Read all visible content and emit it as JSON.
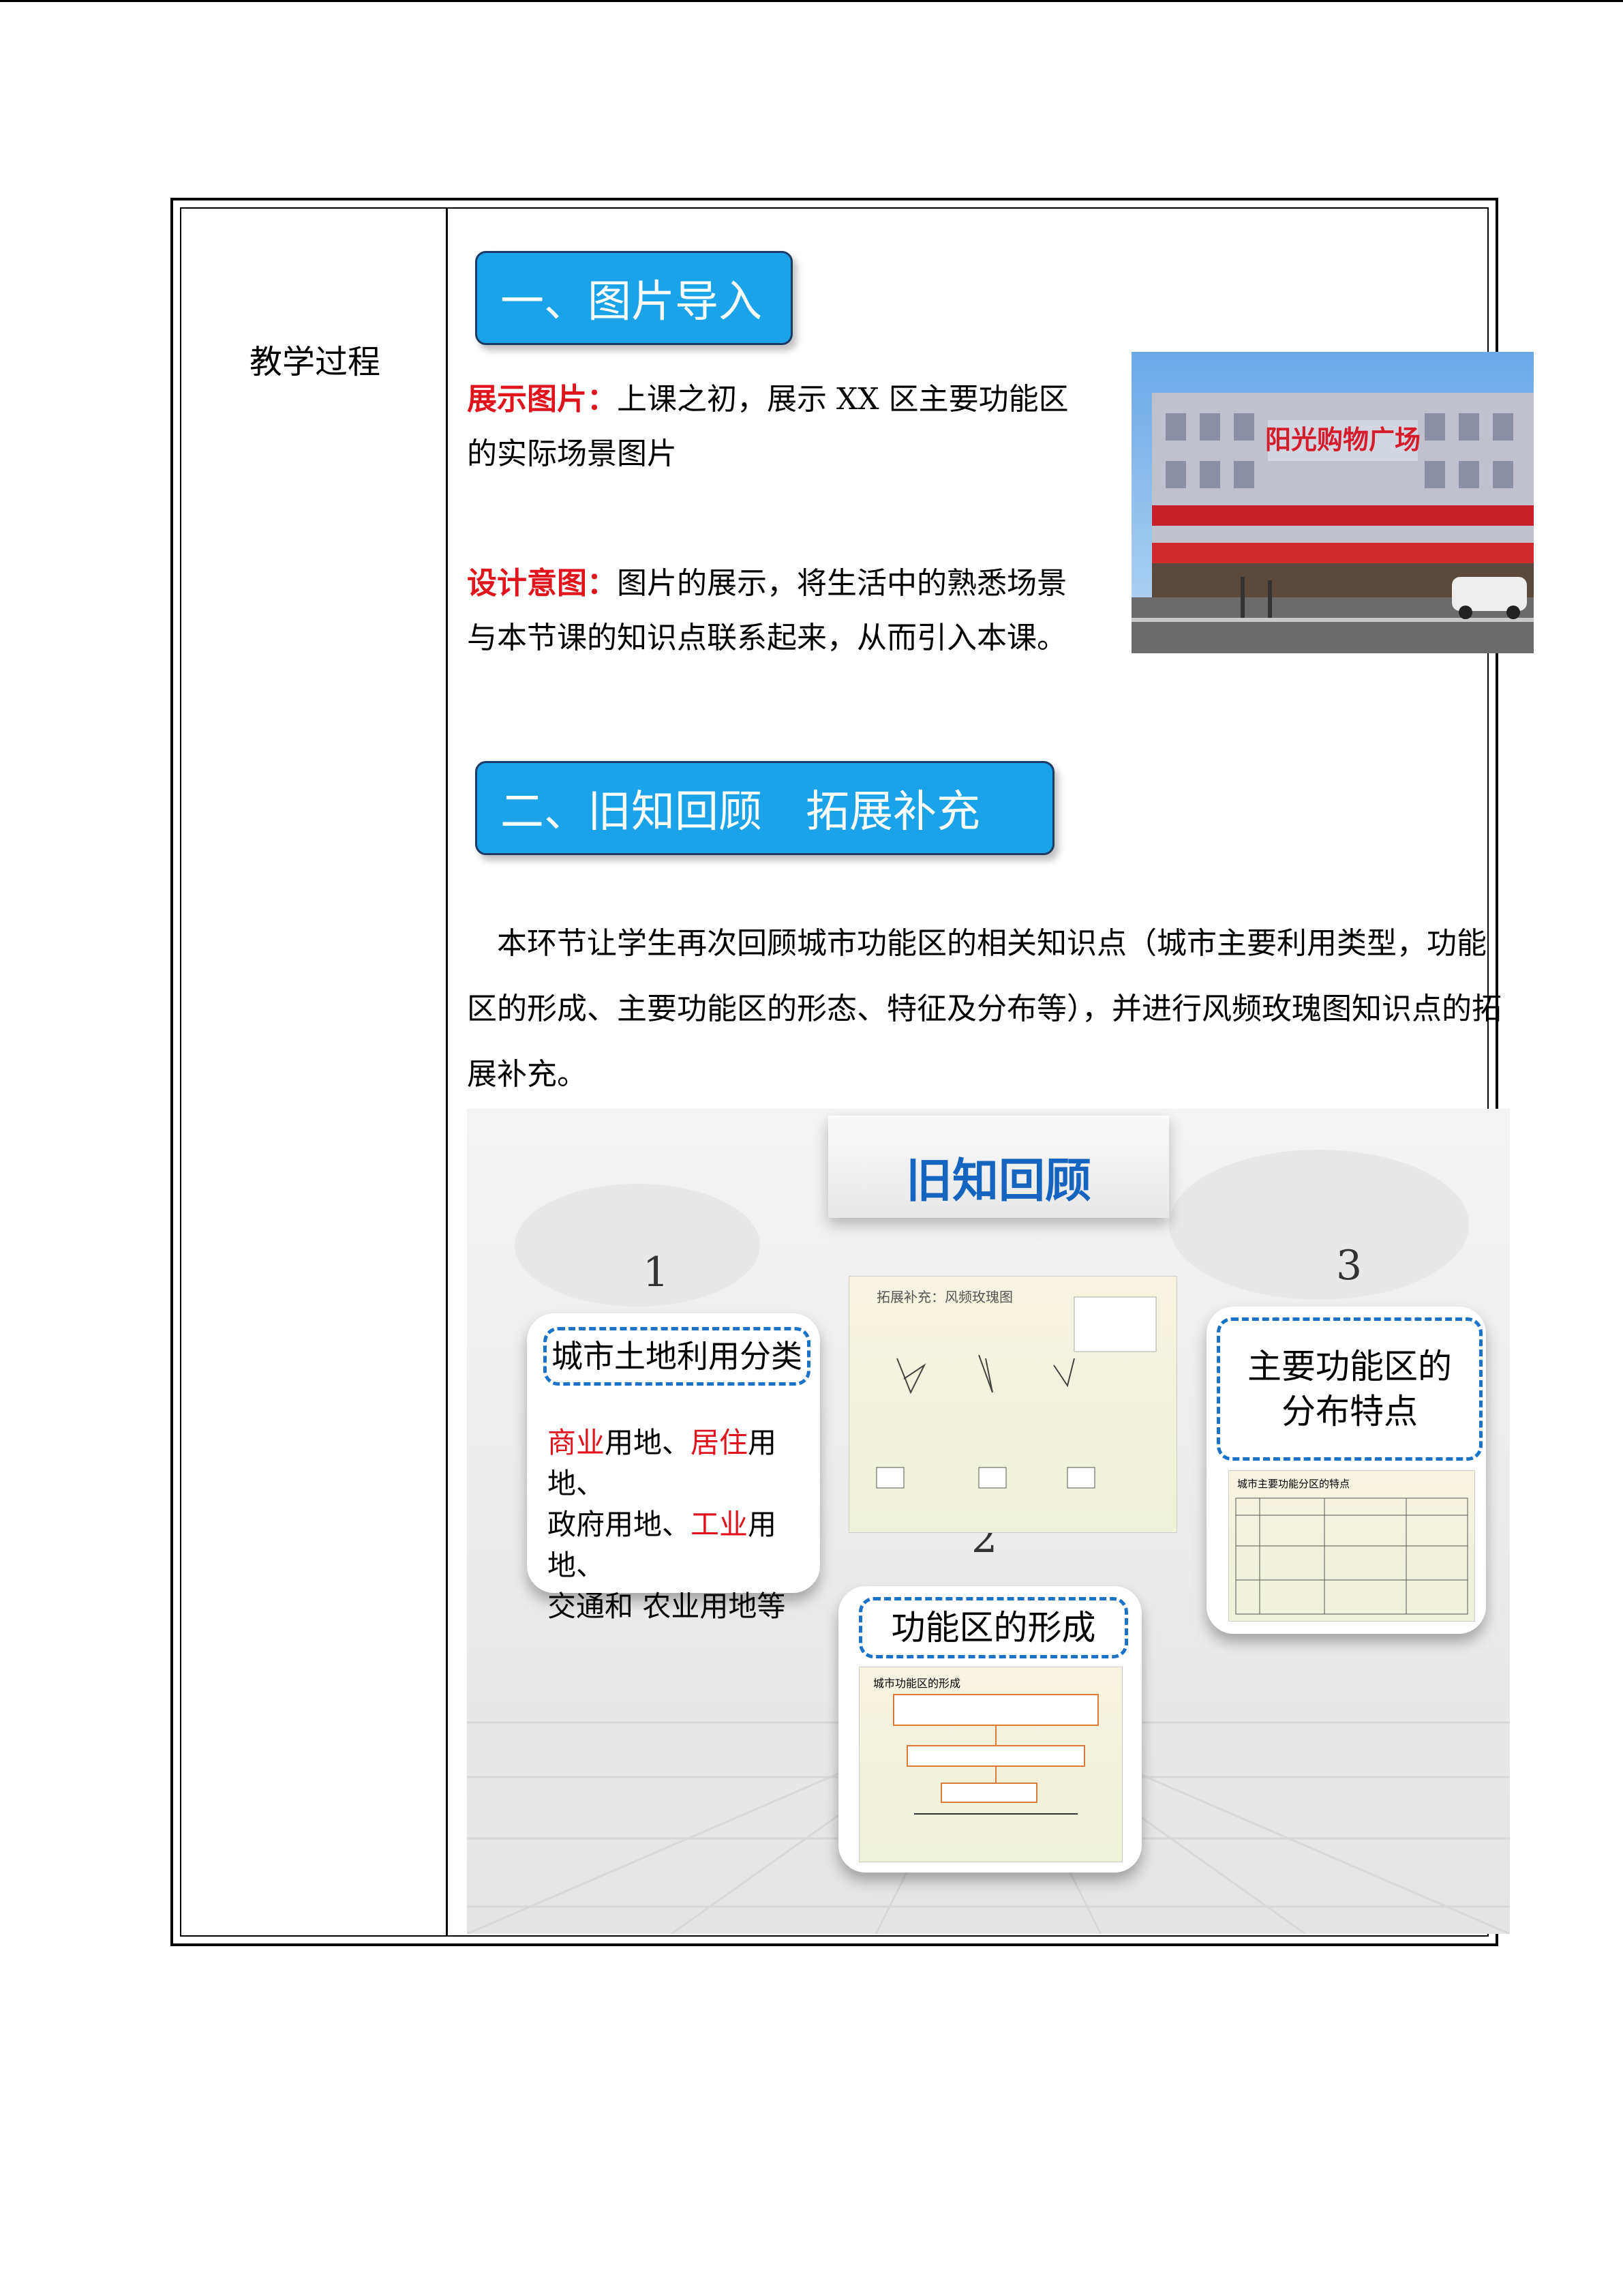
{
  "left_label": "教学过程",
  "section1": {
    "title": "一、图片导入",
    "show_label": "展示图片：",
    "show_text": "上课之初，展示 XX 区主要功能区的实际场景图片",
    "intent_label": "设计意图：",
    "intent_text": "图片的展示，将生活中的熟悉场景与本节课的知识点联系起来，从而引入本课。",
    "photo_sign": "阳光购物广场"
  },
  "section2": {
    "title": "二、旧知回顾　拓展补充",
    "paragraph": "本环节让学生再次回顾城市功能区的相关知识点（城市主要利用类型，功能区的形成、主要功能区的形态、特征及分布等），并进行风频玫瑰图知识点的拓展补充。"
  },
  "slide": {
    "title": "旧知回顾",
    "num1": "1",
    "num2": "2",
    "num3": "3",
    "card1_title": "城市土地利用分类",
    "card1_line1_a": "商业",
    "card1_line1_b": "用地、",
    "card1_line1_c": "居住",
    "card1_line1_d": "用地、",
    "card1_line2_a": "政府用地、",
    "card1_line2_b": "工业",
    "card1_line2_c": "用地、",
    "card1_line3": "交通和 农业用地等",
    "card2_title": "功能区的形成",
    "card3_title_1": "主要功能区的",
    "card3_title_2": "分布特点",
    "thumb1_title": "拓展补充：风频玫瑰图",
    "thumb2_title": "城市功能区的形成",
    "thumb3_title": "城市主要功能分区的特点"
  }
}
